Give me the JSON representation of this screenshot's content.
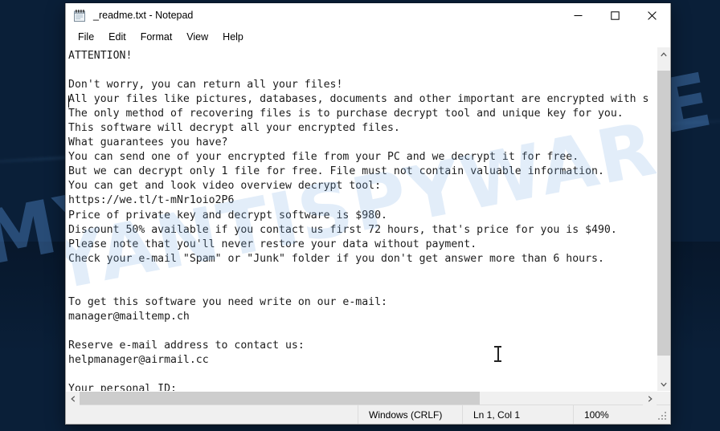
{
  "desktop": {
    "wallpaper_color": "#0a2342",
    "watermark_text": "MYANTISPYWARE.COM",
    "watermark_color": "#5692d6"
  },
  "window": {
    "title": "_readme.txt - Notepad",
    "icon": "notepad-icon",
    "controls": {
      "minimize": "—",
      "maximize": "☐",
      "close": "✕"
    }
  },
  "menu": {
    "items": [
      {
        "label": "File"
      },
      {
        "label": "Edit"
      },
      {
        "label": "Format"
      },
      {
        "label": "View"
      },
      {
        "label": "Help"
      }
    ]
  },
  "editor": {
    "body": "ATTENTION!\n\nDon't worry, you can return all your files!\nAll your files like pictures, databases, documents and other important are encrypted with s\nThe only method of recovering files is to purchase decrypt tool and unique key for you.\nThis software will decrypt all your encrypted files.\nWhat guarantees you have?\nYou can send one of your encrypted file from your PC and we decrypt it for free.\nBut we can decrypt only 1 file for free. File must not contain valuable information.\nYou can get and look video overview decrypt tool:\nhttps://we.tl/t-mNr1oio2P6\nPrice of private key and decrypt software is $980.\nDiscount 50% available if you contact us first 72 hours, that's price for you is $490.\nPlease note that you'll never restore your data without payment.\nCheck your e-mail \"Spam\" or \"Junk\" folder if you don't get answer more than 6 hours.\n\n\nTo get this software you need write on our e-mail:\nmanager@mailtemp.ch\n\nReserve e-mail address to contact us:\nhelpmanager@airmail.cc\n\nYour personal ID:",
    "ransom_details": {
      "price_full": "$980",
      "price_discounted": "$490",
      "discount_percent": "50%",
      "discount_window_hours": "72",
      "answer_window_hours": "6",
      "free_decrypt_files": "1",
      "video_url": "https://we.tl/t-mNr1oio2P6",
      "primary_email": "manager@mailtemp.ch",
      "reserve_email": "helpmanager@airmail.cc"
    }
  },
  "scrollbars": {
    "vertical": {
      "up_arrow": "⌃",
      "down_arrow": "⌄"
    },
    "horizontal": {
      "left_arrow": "‹",
      "right_arrow": "›"
    }
  },
  "statusbar": {
    "encoding": "Windows (CRLF)",
    "cursor": "Ln 1, Col 1",
    "zoom": "100%"
  }
}
